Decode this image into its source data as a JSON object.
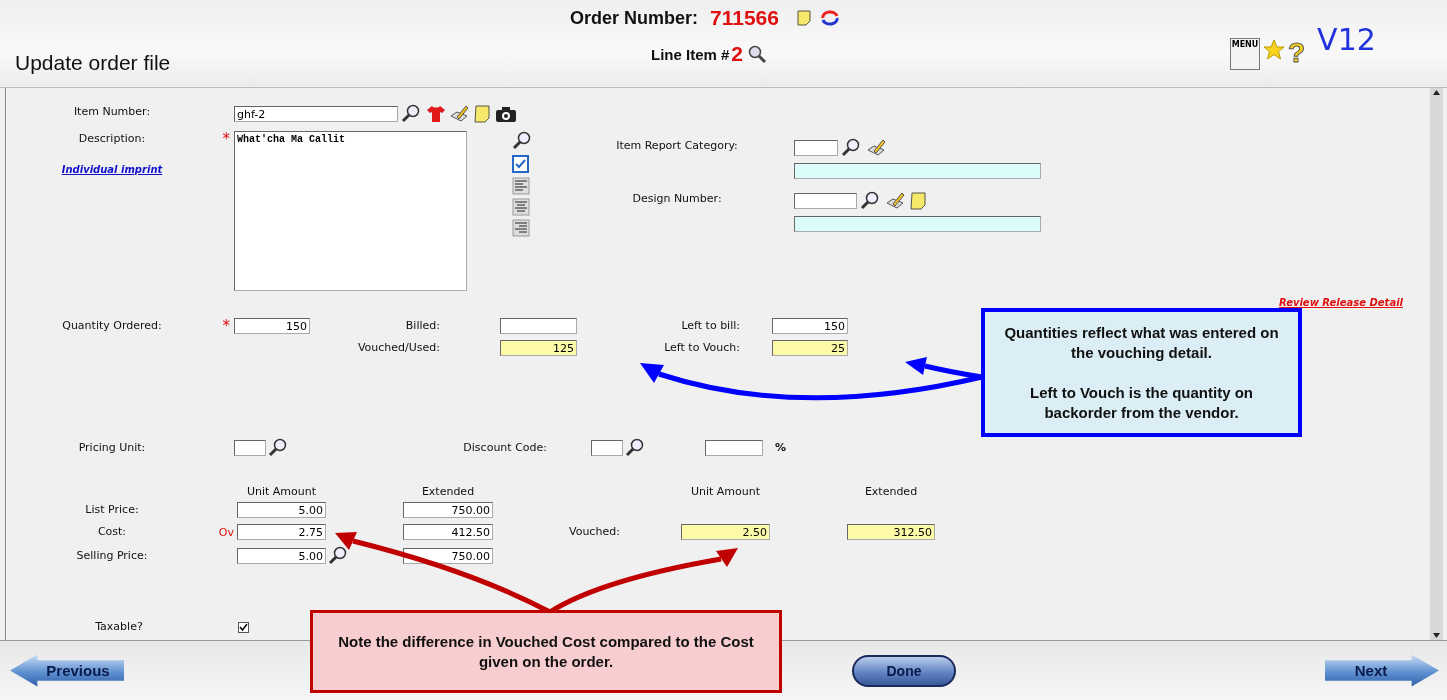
{
  "header": {
    "title": "Update order file",
    "order_label": "Order Number:",
    "order_number": "711566",
    "line_item_label": "Line Item #",
    "line_item_number": "2",
    "menu_label": "MENU",
    "help": "?",
    "version": "V12"
  },
  "item": {
    "number_label": "Item Number:",
    "number": "ghf-2",
    "description_label": "Description:",
    "required_mark": "*",
    "description": "What'cha Ma Callit",
    "imprint_link": "Individual imprint"
  },
  "categories": [
    {
      "label": "Item Report Category:"
    },
    {
      "label": "Design Number:"
    }
  ],
  "review_link": "Review Release Detail",
  "quantities": [
    {
      "label": "Quantity Ordered:",
      "value": "150",
      "required_mark": "*",
      "billed_label": "Billed:",
      "billed_highlighted": false,
      "left_label": "Left to bill:",
      "left_value": "150",
      "left_highlighted": false
    },
    {
      "billed_label": "Vouched/Used:",
      "billed_value": "125",
      "billed_highlighted": true,
      "left_label": "Left to Vouch:",
      "left_value": "25",
      "left_highlighted": true
    }
  ],
  "pricing_unit_label": "Pricing Unit:",
  "discount_label": "Discount Code:",
  "percent": "%",
  "columns": [
    "Unit Amount",
    "Extended",
    "Unit Amount",
    "Extended"
  ],
  "prices": [
    {
      "label": "List Price:",
      "unit": "5.00",
      "extended": "750.00"
    },
    {
      "label": "Cost:",
      "flag": "Ov",
      "unit": "2.75",
      "extended": "412.50",
      "vouched_label": "Vouched:",
      "vouched_unit": "2.50",
      "vouched_extended": "312.50"
    },
    {
      "label": "Selling Price:",
      "unit": "5.00",
      "extended": "750.00",
      "lookup": true
    }
  ],
  "taxable": {
    "label": "Taxable?",
    "checked": true
  },
  "callouts": [
    {
      "color": "#0000ff",
      "paragraphs": [
        "Quantities reflect what was entered on the vouching detail.",
        "Left to Vouch is the quantity on backorder from the vendor."
      ]
    },
    {
      "color": "#c00000",
      "paragraphs": [
        "Note the difference in Vouched Cost compared to the Cost given on the order."
      ]
    }
  ],
  "footer": {
    "previous": "Previous",
    "done": "Done",
    "next": "Next"
  }
}
